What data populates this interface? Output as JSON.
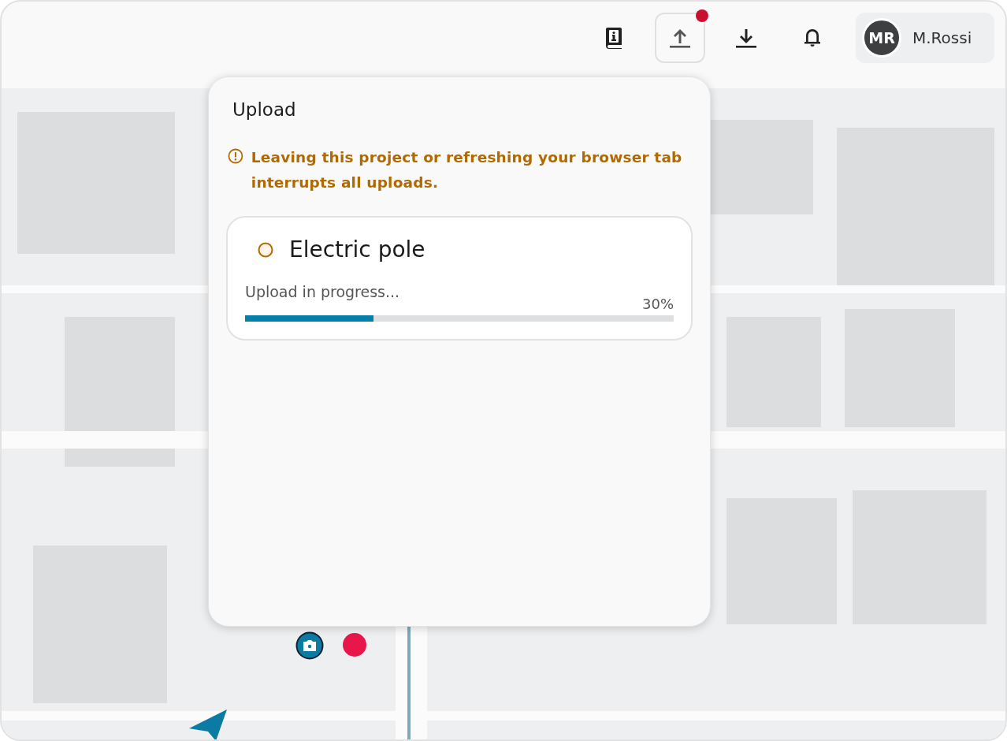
{
  "header": {
    "buttons": [
      {
        "kind": "guide",
        "selected": false,
        "badge": false
      },
      {
        "kind": "upload",
        "selected": true,
        "badge": true
      },
      {
        "kind": "download",
        "selected": false,
        "badge": false
      },
      {
        "kind": "notifications",
        "selected": false,
        "badge": false
      }
    ],
    "user": {
      "initials": "MR",
      "name": "M.Rossi"
    }
  },
  "map": {
    "kind": "picture",
    "markers": [
      {
        "kind": "camera"
      },
      {
        "kind": "dot"
      },
      {
        "kind": "location"
      }
    ]
  },
  "upload_panel": {
    "title": "Upload",
    "warning": "Leaving this project or refreshing your browser tab interrupts all uploads.",
    "items": [
      {
        "name": "Electric pole",
        "status": "Upload in progress...",
        "percent": "30%",
        "level": 0.3
      }
    ]
  }
}
